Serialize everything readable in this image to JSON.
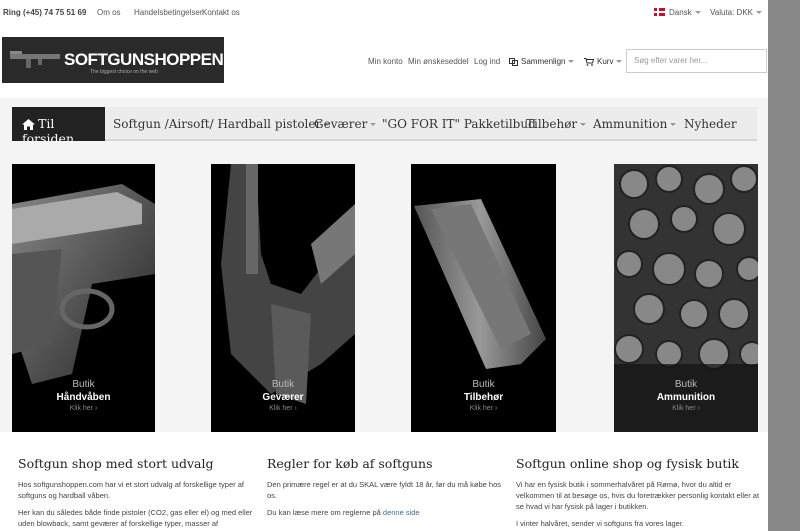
{
  "topbar": {
    "phone": "Ring (+45) 74 75 51 69",
    "links": [
      "Om os",
      "Handelsbetingelser",
      "Kontakt os"
    ],
    "language": "Dansk",
    "currency": "Valuta: DKK"
  },
  "header": {
    "logo_text": "SOFTGUNSHOPPEN.com",
    "logo_tagline": "The biggest choice on the web",
    "account": "Min konto",
    "wishlist": "Min ønskeseddel",
    "login": "Log ind",
    "compare": "Sammenlign",
    "cart": "Kurv",
    "search_placeholder": "Søg efter varer her..."
  },
  "nav": {
    "home": "Til forsiden",
    "items": [
      "Softgun /Airsoft/ Hardball pistoler",
      "Geværer",
      "\"GO FOR IT\" Pakketilbud",
      "Tilbehør",
      "Ammunition",
      "Nyheder"
    ]
  },
  "categories": [
    {
      "sup": "Butik",
      "name": "Håndvåben",
      "more": "Klik her ›",
      "icon": "pistol-image"
    },
    {
      "sup": "Butik",
      "name": "Geværer",
      "more": "Klik her ›",
      "icon": "rifle-image"
    },
    {
      "sup": "Butik",
      "name": "Tilbehør",
      "more": "Klik her ›",
      "icon": "magazine-image"
    },
    {
      "sup": "Butik",
      "name": "Ammunition",
      "more": "Klik her ›",
      "icon": "bullets-image"
    }
  ],
  "content": {
    "col1": {
      "title": "Softgun shop med stort udvalg",
      "p1": "Hos softgunshoppen.com har vi et stort udvalg af forskellige typer af softguns og hardball våben.",
      "p2": "Her kan du således både finde pistoler (CO2, gas eller el) og med eller uden blowback, samt geværer af forskellige typer, masser af"
    },
    "col2": {
      "title": "Regler for køb af softguns",
      "p1": "Den primære regel er at du SKAL være fyldt 18 år, før du må købe hos os.",
      "p2_pre": "Du kan læse mere om reglerne på",
      "p2_link": "denne side"
    },
    "col3": {
      "title": "Softgun online shop og fysisk butik",
      "p1": "Vi har en fysisk butik i sommerhalvåret på Rømø, hvor du altid er velkommen til at besøge os, hvis du foretrækker personlig kontakt eller at se hvad vi har fysisk på lager i butikken.",
      "p2": "I vinter halvåret, sender vi softguns fra vores lager."
    }
  },
  "colors": {
    "nav_active": "#222222",
    "link": "#3a6fa8",
    "flag_red": "#c8102e"
  }
}
